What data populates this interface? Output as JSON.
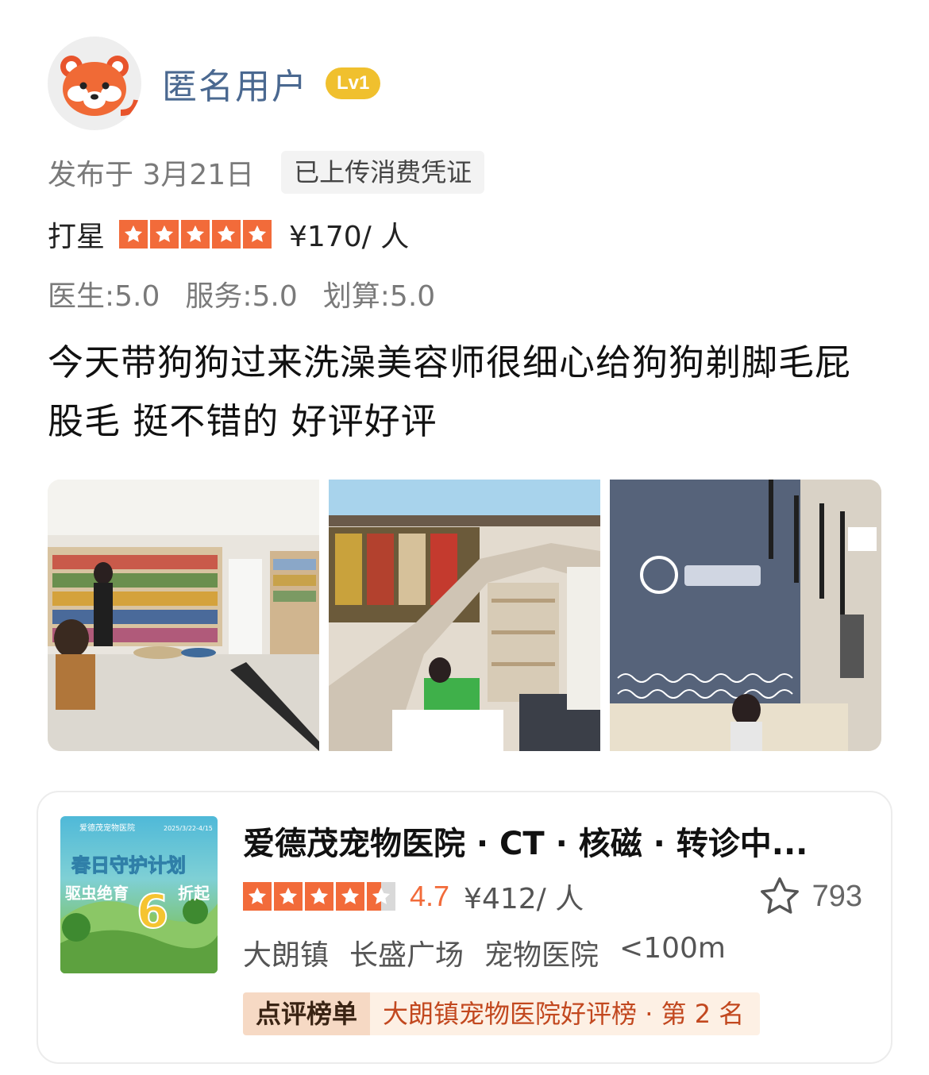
{
  "user": {
    "name": "匿名用户",
    "level": "Lv1"
  },
  "meta": {
    "publish_date": "发布于 3月21日",
    "voucher": "已上传消费凭证"
  },
  "rating": {
    "label": "打星",
    "stars": 5,
    "price": "¥170/ 人"
  },
  "scores": [
    "医生:5.0",
    "服务:5.0",
    "划算:5.0"
  ],
  "review": "今天带狗狗过来洗澡美容师很细心给狗狗剃脚毛屁股毛 挺不错的 好评好评",
  "photos": [
    {
      "label": "pet-store-interior-photo"
    },
    {
      "label": "hospital-staircase-photo"
    },
    {
      "label": "reception-desk-photo"
    }
  ],
  "shop": {
    "name": "爱德茂宠物医院 · CT · 核磁 · 转诊中...",
    "stars": 4.5,
    "score": "4.7",
    "price": "¥412/ 人",
    "favorites": "793",
    "location": [
      "大朗镇",
      "长盛广场",
      "宠物医院",
      "<100m"
    ],
    "rank_badge": "点评榜单",
    "rank_text": "大朗镇宠物医院好评榜 · 第 2 名",
    "thumb": {
      "brand": "爱德茂宠物医院",
      "date_range": "2025/3/22-4/15",
      "headline": "春日守护计划",
      "line": "驱虫绝育",
      "discount": "6",
      "discount_suffix": "折起"
    }
  },
  "colors": {
    "accent": "#f26b3a",
    "username": "#4a6890",
    "badge": "#f0c02e"
  }
}
